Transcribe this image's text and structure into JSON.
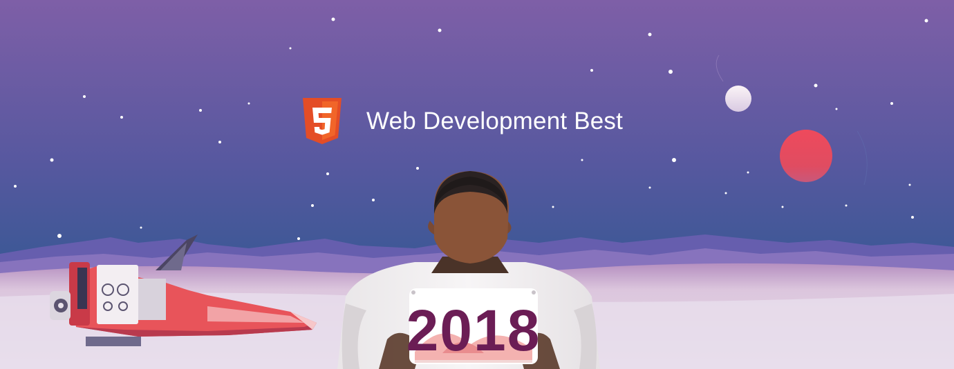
{
  "banner": {
    "title": "Web Development Best",
    "logo": "html5-logo",
    "bib_number": "2018"
  },
  "colors": {
    "sky_top": "#7e5fa7",
    "sky_bottom": "#3d5896",
    "html5_orange": "#e44d26",
    "html5_orange_light": "#f16529",
    "planet_red": "#e84a5f",
    "planet_white": "#f0e6f0",
    "bib_text": "#6b1d55",
    "spaceship_red": "#e8545a"
  }
}
